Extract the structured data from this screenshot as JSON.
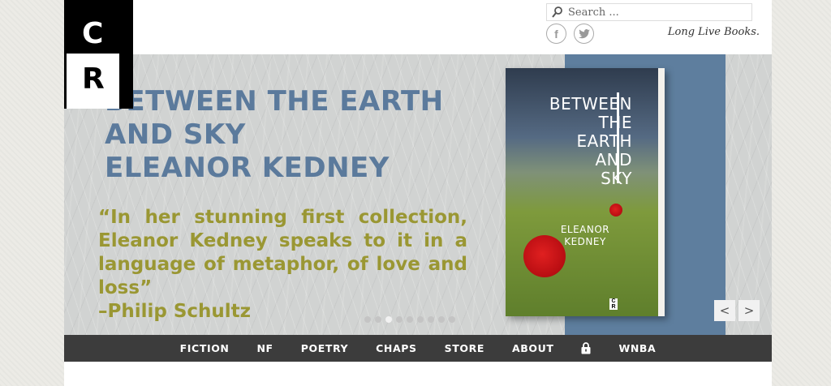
{
  "header": {
    "logo": {
      "line1": "C",
      "line2": "R"
    },
    "search": {
      "placeholder": "Search ...",
      "value": ""
    },
    "social": [
      {
        "icon": "facebook-icon",
        "glyph": "f"
      },
      {
        "icon": "twitter-icon",
        "glyph": "t"
      }
    ],
    "tagline": "Long Live Books."
  },
  "slider": {
    "heading": [
      "BETWEEN THE EARTH",
      "AND SKY",
      "ELEANOR KEDNEY"
    ],
    "quote": "“In her stunning first collection, Eleanor Kedney speaks to it in a language of metaphor, of love and loss”",
    "quote_attribution": "–Philip Schultz",
    "book": {
      "title": [
        "BETWEEN",
        "THE",
        "EARTH",
        "AND",
        "SKY"
      ],
      "author": [
        "ELEANOR",
        "KEDNEY"
      ],
      "logo_text": "C R"
    },
    "dots_count": 9,
    "active_dot": 2,
    "prev_label": "<",
    "next_label": ">",
    "colors": {
      "heading": "#5b7a9c",
      "quote": "#9a9733",
      "band": "#5e7e9e"
    }
  },
  "nav": {
    "items": [
      {
        "label": "FICTION"
      },
      {
        "label": "NF"
      },
      {
        "label": "POETRY"
      },
      {
        "label": "CHAPS"
      },
      {
        "label": "STORE"
      },
      {
        "label": "ABOUT"
      },
      {
        "icon": "lock-icon"
      },
      {
        "label": "WNBA"
      }
    ]
  }
}
